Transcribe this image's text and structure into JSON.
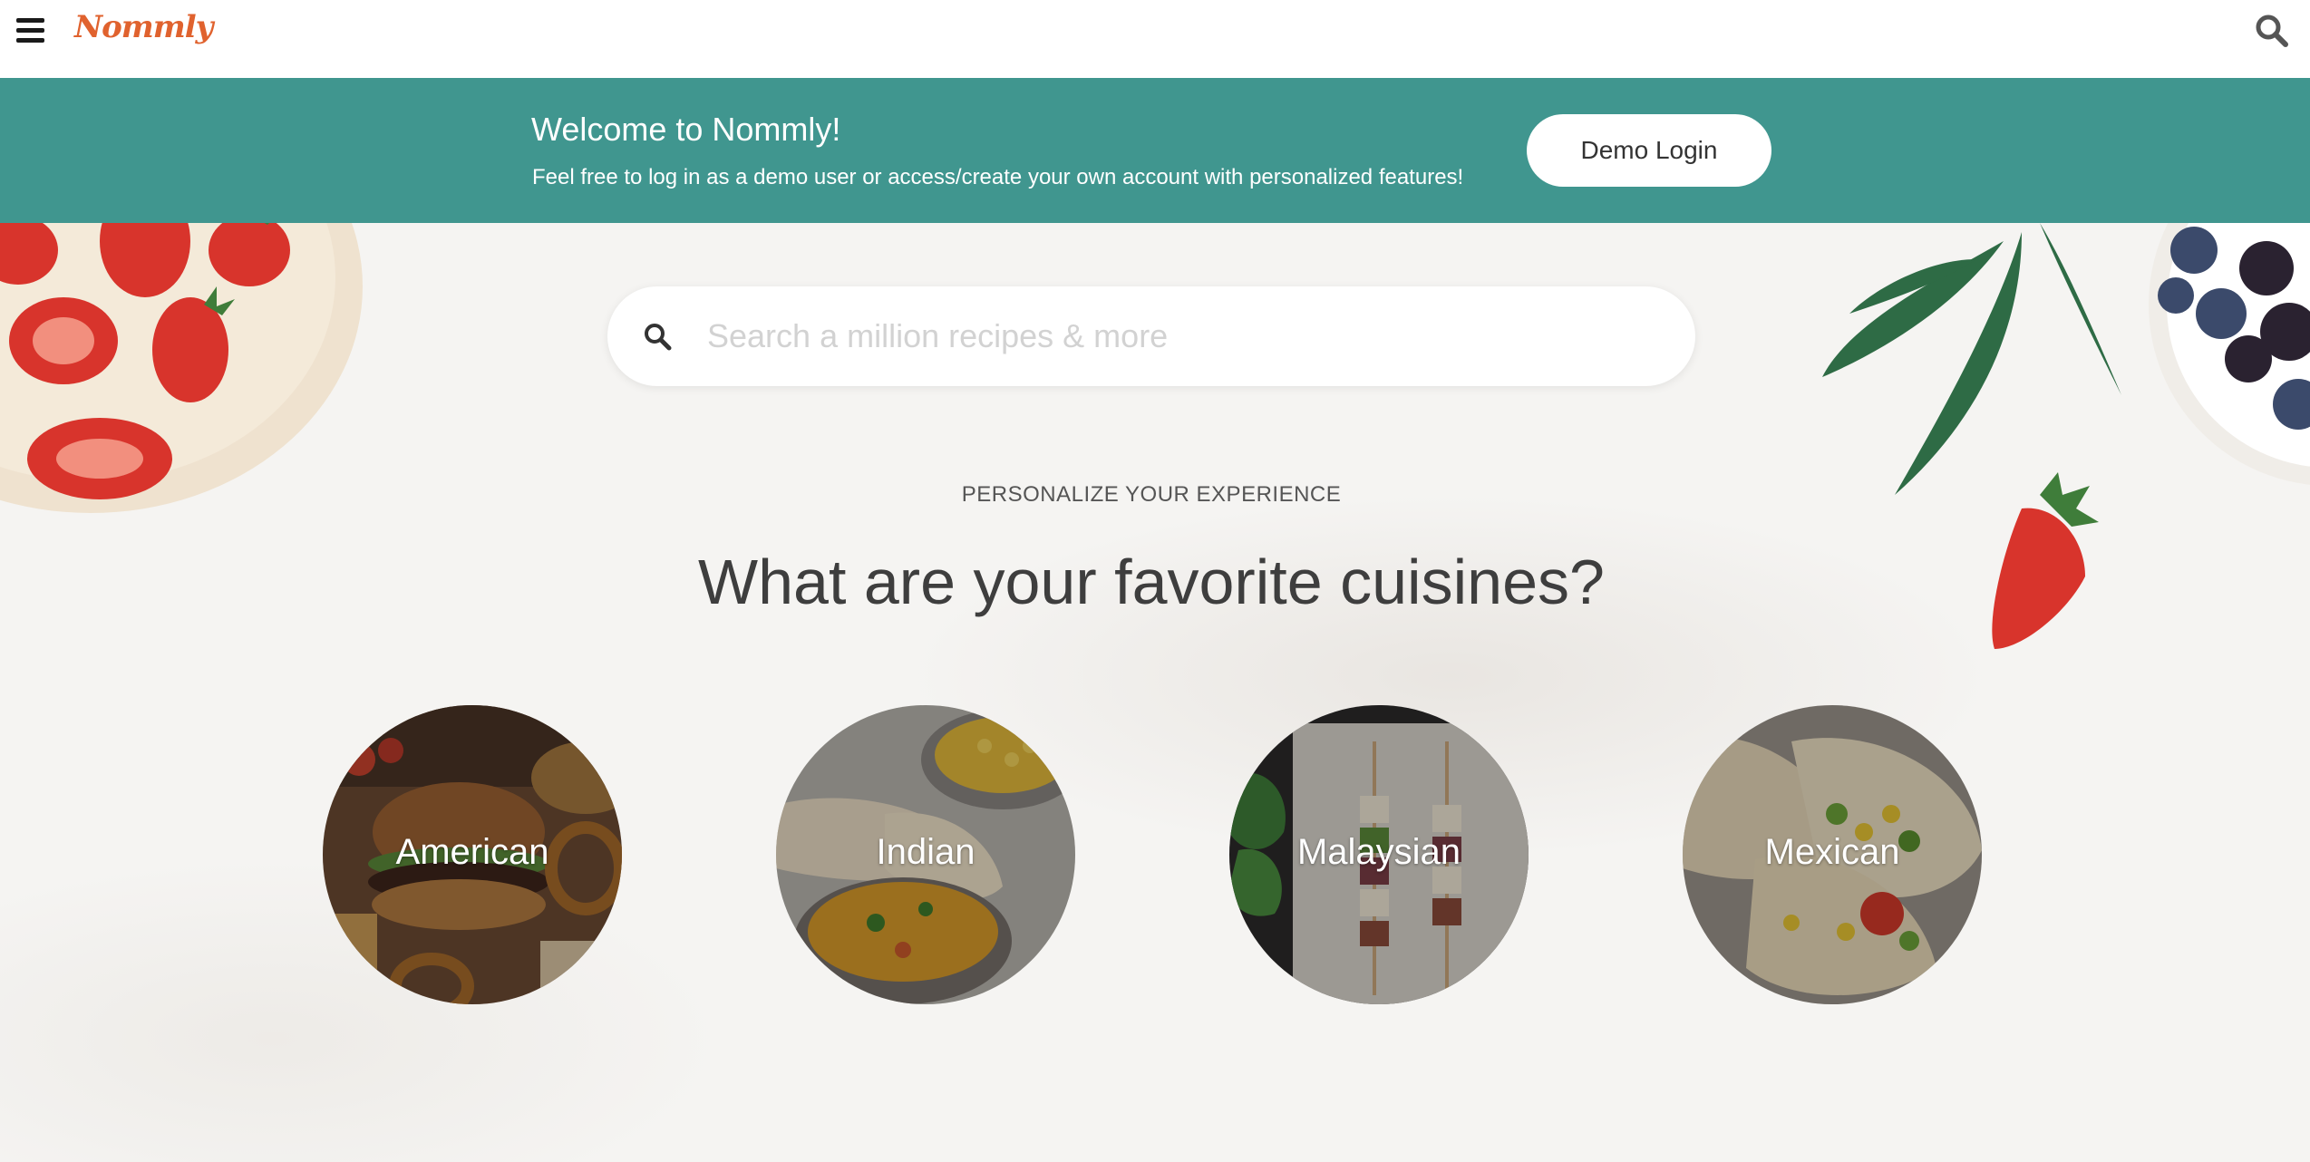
{
  "nav": {
    "logo_text": "Nommly",
    "brand_color": "#e0622e",
    "menu_icon": "hamburger-menu-icon",
    "search_icon": "search-icon"
  },
  "banner": {
    "title": "Welcome to Nommly!",
    "subtitle": "Feel free to log in as a demo user or access/create your own account with personalized features!",
    "demo_button_label": "Demo Login",
    "background_color": "#40968f"
  },
  "search": {
    "placeholder": "Search a million recipes & more",
    "value": ""
  },
  "personalize": {
    "eyebrow": "PERSONALIZE YOUR EXPERIENCE",
    "headline": "What are your favorite cuisines?"
  },
  "cuisines": [
    {
      "label": "American"
    },
    {
      "label": "Indian"
    },
    {
      "label": "Malaysian"
    },
    {
      "label": "Mexican"
    }
  ]
}
